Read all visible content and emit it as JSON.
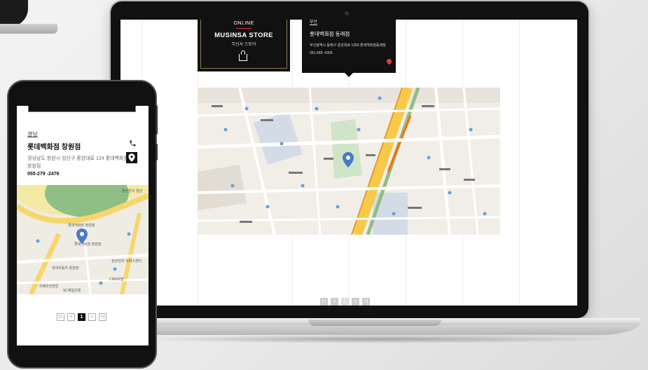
{
  "laptop": {
    "store_card": {
      "online_label": "ONLINE",
      "store_name": "MUSINSA STORE",
      "store_sub": "무신사 스토어",
      "icon": "shopping-bag-icon"
    },
    "popup": {
      "region": "부산",
      "title": "롯데백화점 동래점",
      "address": "부산광역시 동래구 중앙대로 1393 롯데백화점동래점",
      "phone": "051-668 -4309",
      "icon": "location-pin-icon"
    },
    "pagination": {
      "first": "|<",
      "prev": "<",
      "current": "1",
      "next": ">",
      "last": ">|"
    }
  },
  "phone": {
    "region": "경남",
    "title": "롯데백화점 창원점",
    "address": "경상남도 창원시 성산구 중앙대로 124 롯데백화점 창원점",
    "phone": "055-279 -2476",
    "map_labels": [
      "롯데백화점 창원점",
      "롯데백화점 창원점",
      "현대자동차 창원점",
      "SC제일은행",
      "CNN호텔",
      "리베라컨벤션",
      "삼성전자 서비스센터",
      "창원한국 경남"
    ],
    "pagination": {
      "first": "|<",
      "prev": "<",
      "current": "1",
      "next": ">",
      "last": ">|"
    }
  },
  "colors": {
    "accent_red": "#e34444",
    "card_black": "#111111",
    "map_road": "#f7c948",
    "map_green": "#8fbf84"
  }
}
